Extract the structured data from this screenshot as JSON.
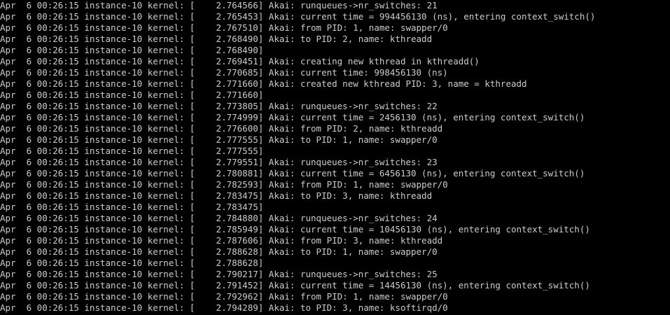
{
  "terminal": {
    "lines": [
      "Apr  6 00:26:15 instance-10 kernel: [    2.764566] Akai: runqueues->nr_switches: 21",
      "Apr  6 00:26:15 instance-10 kernel: [    2.765453] Akai: current time = 994456130 (ns), entering context_switch()",
      "Apr  6 00:26:15 instance-10 kernel: [    2.767510] Akai: from PID: 1, name: swapper/0",
      "Apr  6 00:26:15 instance-10 kernel: [    2.768490] Akai: to PID: 2, name: kthreadd",
      "Apr  6 00:26:15 instance-10 kernel: [    2.768490]",
      "Apr  6 00:26:15 instance-10 kernel: [    2.769451] Akai: creating new kthread in kthreadd()",
      "Apr  6 00:26:15 instance-10 kernel: [    2.770685] Akai: current time: 998456130 (ns)",
      "Apr  6 00:26:15 instance-10 kernel: [    2.771660] Akai: created new kthread PID: 3, name = kthreadd",
      "Apr  6 00:26:15 instance-10 kernel: [    2.771660]",
      "Apr  6 00:26:15 instance-10 kernel: [    2.773805] Akai: runqueues->nr_switches: 22",
      "Apr  6 00:26:15 instance-10 kernel: [    2.774999] Akai: current time = 2456130 (ns), entering context_switch()",
      "Apr  6 00:26:15 instance-10 kernel: [    2.776600] Akai: from PID: 2, name: kthreadd",
      "Apr  6 00:26:15 instance-10 kernel: [    2.777555] Akai: to PID: 1, name: swapper/0",
      "Apr  6 00:26:15 instance-10 kernel: [    2.777555]",
      "Apr  6 00:26:15 instance-10 kernel: [    2.779551] Akai: runqueues->nr_switches: 23",
      "Apr  6 00:26:15 instance-10 kernel: [    2.780881] Akai: current time = 6456130 (ns), entering context_switch()",
      "Apr  6 00:26:15 instance-10 kernel: [    2.782593] Akai: from PID: 1, name: swapper/0",
      "Apr  6 00:26:15 instance-10 kernel: [    2.783475] Akai: to PID: 3, name: kthreadd",
      "Apr  6 00:26:15 instance-10 kernel: [    2.783475]",
      "Apr  6 00:26:15 instance-10 kernel: [    2.784880] Akai: runqueues->nr_switches: 24",
      "Apr  6 00:26:15 instance-10 kernel: [    2.785949] Akai: current time = 10456130 (ns), entering context_switch()",
      "Apr  6 00:26:15 instance-10 kernel: [    2.787606] Akai: from PID: 3, name: kthreadd",
      "Apr  6 00:26:15 instance-10 kernel: [    2.788628] Akai: to PID: 1, name: swapper/0",
      "Apr  6 00:26:15 instance-10 kernel: [    2.788628]",
      "Apr  6 00:26:15 instance-10 kernel: [    2.790217] Akai: runqueues->nr_switches: 25",
      "Apr  6 00:26:15 instance-10 kernel: [    2.791452] Akai: current time = 14456130 (ns), entering context_switch()",
      "Apr  6 00:26:15 instance-10 kernel: [    2.792962] Akai: from PID: 1, name: swapper/0",
      "Apr  6 00:26:15 instance-10 kernel: [    2.794289] Akai: to PID: 3, name: ksoftirqd/0"
    ]
  },
  "colors": {
    "background": "#000000",
    "text": "#cccccc"
  }
}
